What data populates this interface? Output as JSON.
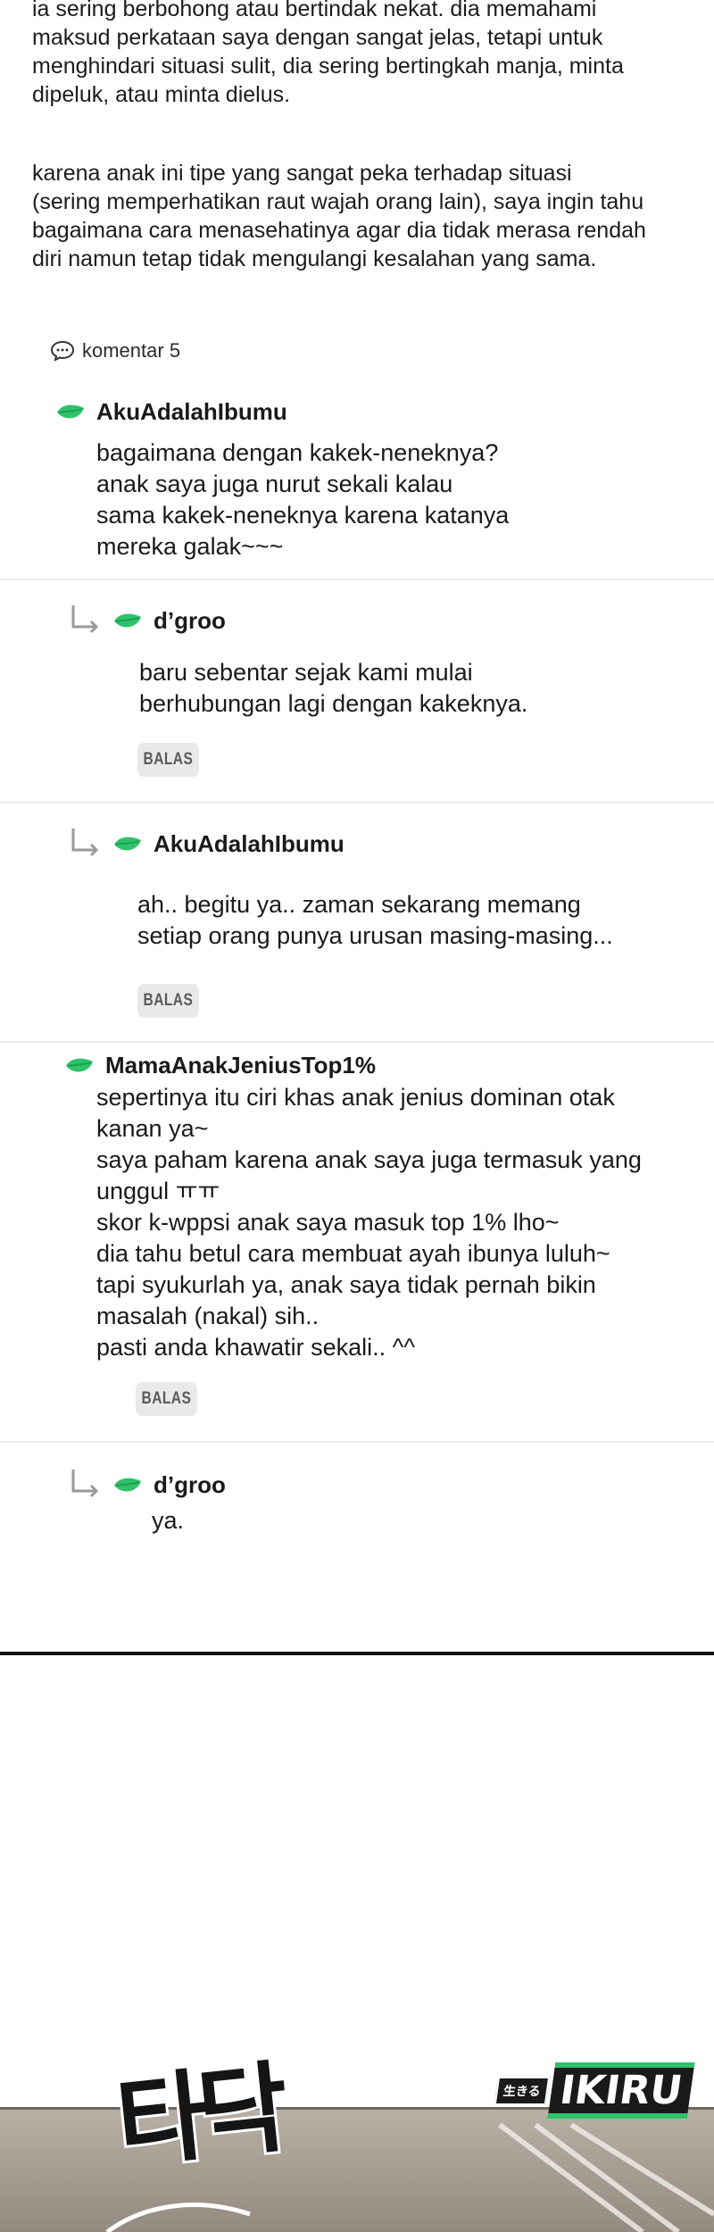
{
  "post": {
    "paragraph1": [
      "ia sering berbohong atau bertindak nekat. dia memahami",
      "maksud perkataan saya dengan sangat jelas, tetapi untuk",
      "menghindari situasi sulit, dia sering bertingkah manja, minta",
      "dipeluk, atau minta dielus."
    ],
    "paragraph2": [
      "karena anak ini tipe yang sangat peka terhadap situasi",
      "(sering memperhatikan raut wajah orang lain), saya ingin tahu",
      "bagaimana cara menasehatinya agar dia tidak merasa rendah",
      "diri namun tetap tidak mengulangi kesalahan yang sama."
    ]
  },
  "comments_header": {
    "label": "komentar 5",
    "icon": "speech-bubble-icon"
  },
  "comments": [
    {
      "author": "AkuAdalahIbumu",
      "lines": [
        "bagaimana dengan kakek-neneknya?",
        "anak saya juga nurut sekali kalau",
        "sama kakek-neneknya karena katanya",
        "mereka galak~~~"
      ]
    },
    {
      "author": "d’groo",
      "reply": true,
      "lines": [
        "baru sebentar sejak kami mulai",
        "berhubungan lagi dengan kakeknya."
      ],
      "button": "BALAS"
    },
    {
      "author": "AkuAdalahIbumu",
      "reply": true,
      "lines": [
        "ah.. begitu ya.. zaman sekarang memang",
        "setiap orang punya urusan masing-masing..."
      ],
      "button": "BALAS"
    },
    {
      "author": "MamaAnakJeniusTop1%",
      "lines": [
        "sepertinya itu ciri khas anak jenius dominan otak",
        "kanan ya~",
        "saya paham karena anak saya juga termasuk yang",
        "unggul ㅠㅠ",
        "skor k-wppsi anak saya masuk top 1% lho~",
        "dia tahu betul cara membuat ayah ibunya luluh~",
        "tapi syukurlah ya, anak saya tidak pernah bikin",
        "masalah (nakal) sih..",
        "pasti anda khawatir sekali.. ^^"
      ],
      "button": "BALAS"
    },
    {
      "author": "d’groo",
      "reply": true,
      "lines": [
        "ya."
      ]
    }
  ],
  "art": {
    "sfx": "타닥",
    "logo_small": "生きる",
    "logo_main": "IKIRU"
  },
  "colors": {
    "leaf": "#2ec26a",
    "leaf_dark": "#1f9d52",
    "button_bg": "#e9e9e9",
    "separator": "#ececec"
  }
}
